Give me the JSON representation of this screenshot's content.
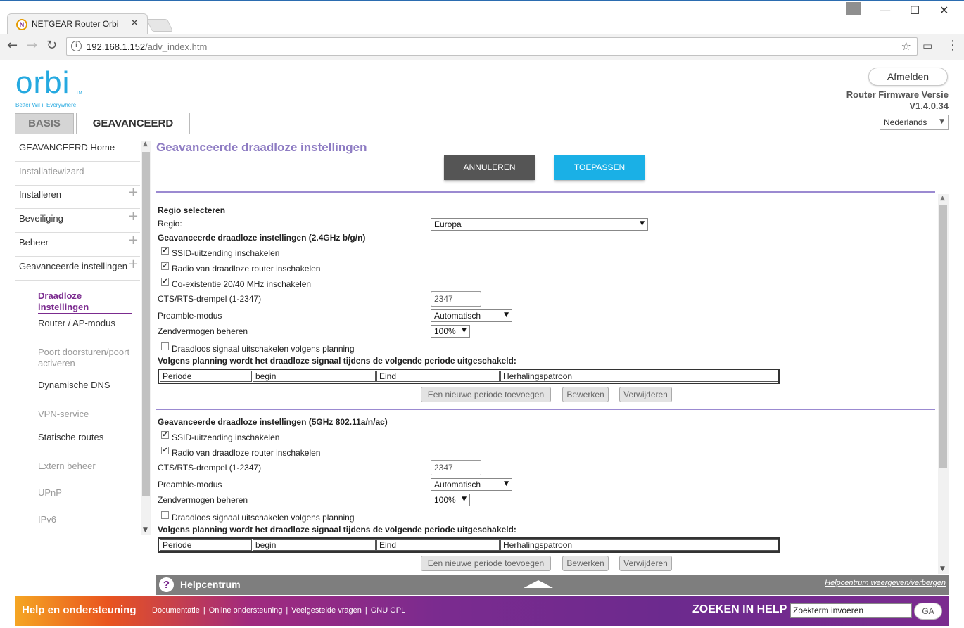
{
  "browser": {
    "tab_title": "NETGEAR Router Orbi",
    "tab_favicon": "N",
    "url_host": "192.168.1.152",
    "url_path": "/adv_index.htm"
  },
  "header": {
    "logo": "orbi",
    "logo_tm": "TM",
    "tagline": "Better WiFi. Everywhere.",
    "logout_label": "Afmelden",
    "firmware_label": "Router Firmware Versie",
    "firmware_version": "V1.4.0.34",
    "language": "Nederlands"
  },
  "tabs": {
    "basis": "BASIS",
    "advanced": "GEAVANCEERD"
  },
  "nav": {
    "items": [
      {
        "label": "GEAVANCEERD Home",
        "has_plus": false,
        "disabled": false
      },
      {
        "label": "Installatiewizard",
        "has_plus": false,
        "disabled": true
      },
      {
        "label": "Installeren",
        "has_plus": true,
        "disabled": false
      },
      {
        "label": "Beveiliging",
        "has_plus": true,
        "disabled": false
      },
      {
        "label": "Beheer",
        "has_plus": true,
        "disabled": false
      },
      {
        "label": "Geavanceerde instellingen",
        "has_plus": true,
        "disabled": false
      }
    ],
    "plus_icon": "+",
    "sub_items": [
      {
        "label": "Draadloze instellingen",
        "state": "active"
      },
      {
        "label": "Router / AP-modus",
        "state": "normal"
      },
      {
        "label": "Poort doorsturen/poort activeren",
        "state": "disabled"
      },
      {
        "label": "Dynamische DNS",
        "state": "normal"
      },
      {
        "label": "VPN-service",
        "state": "disabled"
      },
      {
        "label": "Statische routes",
        "state": "normal"
      },
      {
        "label": "Extern beheer",
        "state": "disabled"
      },
      {
        "label": "UPnP",
        "state": "disabled"
      },
      {
        "label": "IPv6",
        "state": "disabled"
      }
    ]
  },
  "main": {
    "title": "Geavanceerde draadloze instellingen",
    "cancel_label": "ANNULEREN",
    "apply_label": "TOEPASSEN",
    "region_heading": "Regio selecteren",
    "region_label": "Regio:",
    "region_value": "Europa",
    "band24": {
      "heading": "Geavanceerde draadloze instellingen (2.4GHz b/g/n)",
      "ssid_broadcast": "SSID-uitzending inschakelen",
      "radio_enable": "Radio van draadloze router inschakelen",
      "coexistence": "Co-existentie 20/40 MHz inschakelen",
      "cts_label": "CTS/RTS-drempel (1-2347)",
      "cts_value": "2347",
      "preamble_label": "Preamble-modus",
      "preamble_value": "Automatisch",
      "power_label": "Zendvermogen beheren",
      "power_value": "100%",
      "schedule_checkbox": "Draadloos signaal uitschakelen volgens planning",
      "schedule_note": "Volgens planning wordt het draadloze signaal tijdens de volgende periode uitgeschakeld:"
    },
    "band5": {
      "heading": "Geavanceerde draadloze instellingen (5GHz 802.11a/n/ac)",
      "ssid_broadcast": "SSID-uitzending inschakelen",
      "radio_enable": "Radio van draadloze router inschakelen",
      "cts_label": "CTS/RTS-drempel (1-2347)",
      "cts_value": "2347",
      "preamble_label": "Preamble-modus",
      "preamble_value": "Automatisch",
      "power_label": "Zendvermogen beheren",
      "power_value": "100%",
      "schedule_checkbox": "Draadloos signaal uitschakelen volgens planning",
      "schedule_note": "Volgens planning wordt het draadloze signaal tijdens de volgende periode uitgeschakeld:"
    },
    "schedule_columns": [
      "Periode",
      "begin",
      "Eind",
      "Herhalingspatroon"
    ],
    "add_period_label": "Een nieuwe periode toevoegen",
    "edit_label": "Bewerken",
    "delete_label": "Verwijderen",
    "check_mark": "✔"
  },
  "helpcenter": {
    "icon": "?",
    "title": "Helpcentrum",
    "toggle_link": "Helpcentrum weergeven/verbergen"
  },
  "footer": {
    "title": "Help en ondersteuning",
    "links": [
      "Documentatie",
      "Online ondersteuning",
      "Veelgestelde vragen",
      "GNU GPL"
    ],
    "search_title": "ZOEKEN IN HELP",
    "search_placeholder": "Zoekterm invoeren",
    "go_label": "GA"
  }
}
